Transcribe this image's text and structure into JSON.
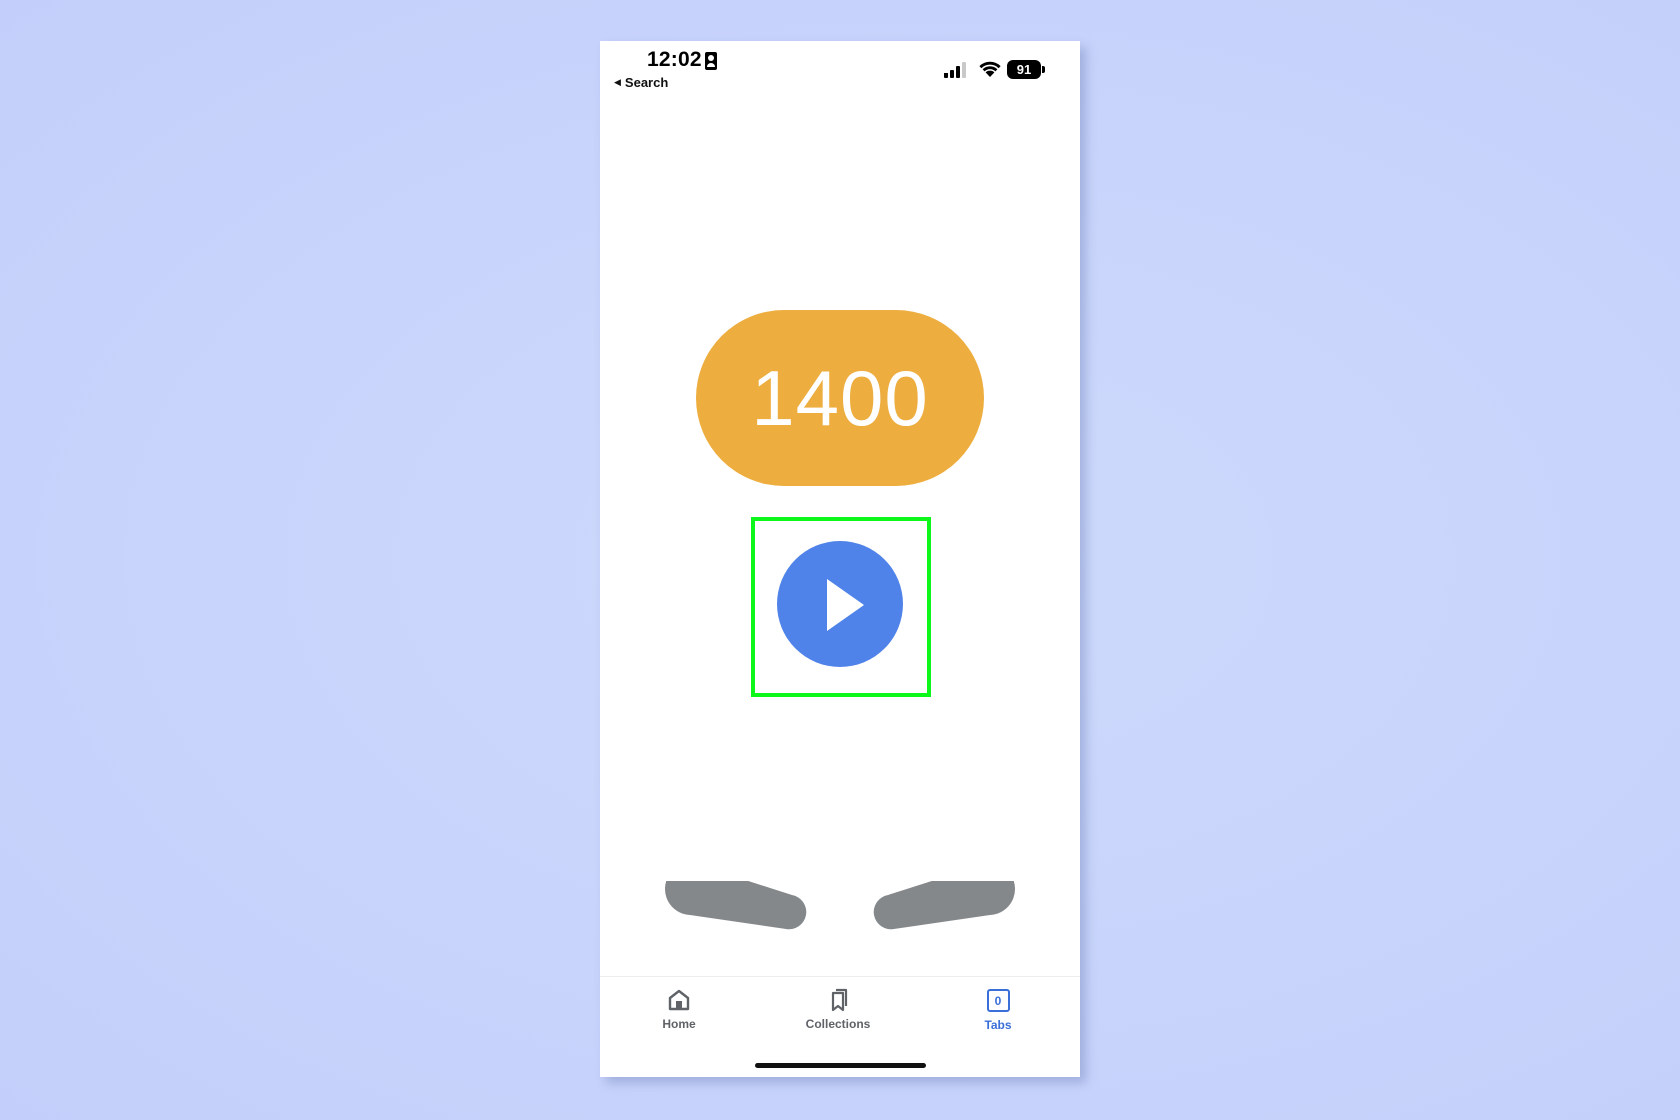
{
  "status_bar": {
    "time": "12:02",
    "back_label": "Search",
    "battery_level": "91",
    "icons": [
      "person-badge-icon",
      "cellular-signal-icon",
      "wifi-icon",
      "battery-icon"
    ]
  },
  "game": {
    "score": "1400",
    "play_icon": "play-icon",
    "colors": {
      "score_bg": "#edad3f",
      "play_bg": "#5083e9",
      "flipper": "#85888b",
      "highlight": "#0df71a"
    }
  },
  "bottom_nav": {
    "items": [
      {
        "label": "Home",
        "icon": "home-icon"
      },
      {
        "label": "Collections",
        "icon": "bookmarks-icon"
      },
      {
        "label": "Tabs",
        "icon": "tabs-icon",
        "count": "0",
        "active": true
      }
    ],
    "active_color": "#3b6fd8"
  }
}
